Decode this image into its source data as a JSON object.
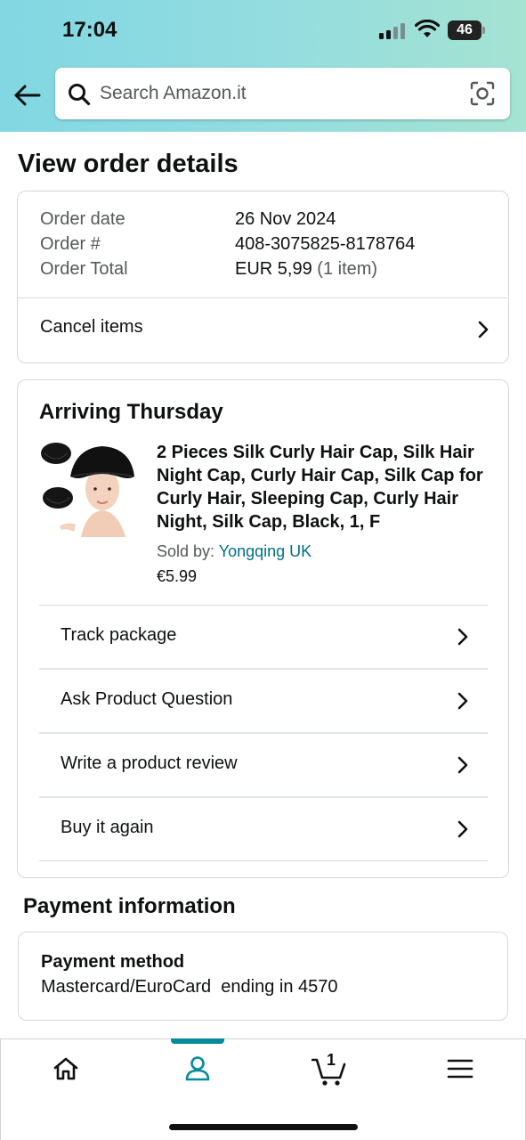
{
  "status_bar": {
    "time": "17:04",
    "battery": "46"
  },
  "search": {
    "placeholder": "Search Amazon.it"
  },
  "page": {
    "title": "View order details"
  },
  "order_summary": {
    "date_label": "Order date",
    "date_value": "26 Nov 2024",
    "number_label": "Order #",
    "number_value": "408-3075825-8178764",
    "total_label": "Order Total",
    "total_value": "EUR 5,99",
    "item_count": "(1 item)",
    "cancel_label": "Cancel items"
  },
  "shipment": {
    "title": "Arriving Thursday",
    "product": {
      "name": "2 Pieces Silk Curly Hair Cap, Silk Hair Night Cap, Curly Hair Cap, Silk Cap for Curly Hair, Sleeping Cap, Curly Hair Night, Silk Cap, Black, 1, F",
      "sold_by_label": "Sold by:",
      "seller": "Yongqing UK",
      "price": "€5.99"
    },
    "actions": [
      "Track package",
      "Ask Product Question",
      "Write a product review",
      "Buy it again"
    ]
  },
  "payment": {
    "section_title": "Payment information",
    "method_label": "Payment method",
    "method_value": "Mastercard/EuroCard  ending in 4570"
  },
  "bottom_nav": {
    "items": [
      "home-icon",
      "account-icon",
      "cart-icon",
      "menu-icon"
    ],
    "active": "account-icon",
    "cart_count": "1"
  },
  "colors": {
    "link": "#007185",
    "accent": "#078b9c",
    "text": "#0f1111",
    "muted": "#565959"
  }
}
